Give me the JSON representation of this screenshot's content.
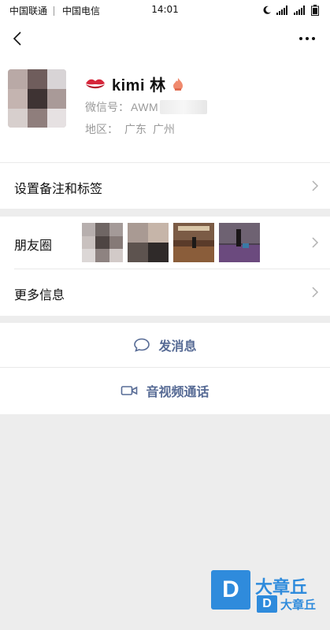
{
  "status_bar": {
    "carrier_1": "中国联通",
    "carrier_2": "中国电信",
    "time": "14:01"
  },
  "profile": {
    "name": "kimi 林",
    "wechat_id_label": "微信号：",
    "wechat_id_value": "AWM",
    "region_label": "地区：",
    "region_province": "广东",
    "region_city": "广州"
  },
  "rows": {
    "set_remark": "设置备注和标签",
    "moments": "朋友圈",
    "more_info": "更多信息"
  },
  "actions": {
    "send_message": "发消息",
    "video_call": "音视频通话"
  },
  "watermark": {
    "logo_letter": "D",
    "title": "大章丘",
    "subtitle": "大章丘"
  },
  "colors": {
    "link_blue": "#576b95",
    "background": "#ededed",
    "watermark_blue": "#2f8bdc"
  },
  "icons": {
    "back": "chevron-left-icon",
    "more": "more-dots-icon",
    "message": "chat-bubble-icon",
    "video": "video-camera-icon"
  }
}
